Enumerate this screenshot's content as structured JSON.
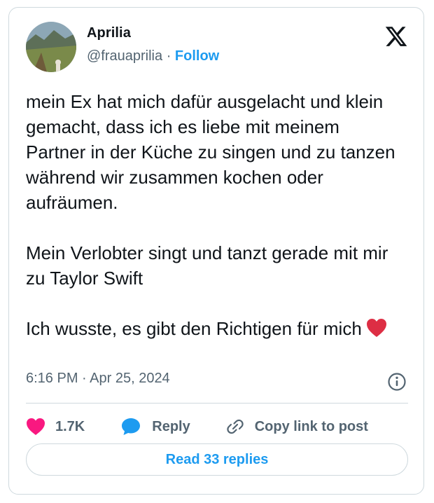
{
  "author": {
    "display_name": "Aprilia",
    "handle": "@frauaprilia",
    "separator": "·",
    "follow_label": "Follow"
  },
  "tweet": {
    "paragraphs": [
      "mein Ex hat mich dafür ausgelacht und klein gemacht, dass ich es liebe mit meinem Partner in der Küche zu singen und zu tanzen während wir zusammen kochen oder aufräumen.",
      "Mein Verlobter singt und tanzt gerade mit mir zu Taylor Swift",
      "Ich wusste, es gibt den Richtigen für mich"
    ],
    "emoji_icon": "red-heart-emoji",
    "timestamp": "6:16 PM · Apr 25, 2024"
  },
  "actions": {
    "like_count": "1.7K",
    "reply_label": "Reply",
    "copy_link_label": "Copy link to post"
  },
  "footer": {
    "read_replies_label": "Read 33 replies"
  },
  "icons": {
    "logo": "x-logo-icon",
    "info": "info-icon",
    "like": "heart-icon",
    "reply": "speech-bubble-icon",
    "copy": "link-icon"
  },
  "colors": {
    "accent": "#1d9bf0",
    "like": "#f91880",
    "emoji_heart": "#dd2e44",
    "text": "#0f1419",
    "muted": "#536471",
    "border": "#cfd9de"
  }
}
